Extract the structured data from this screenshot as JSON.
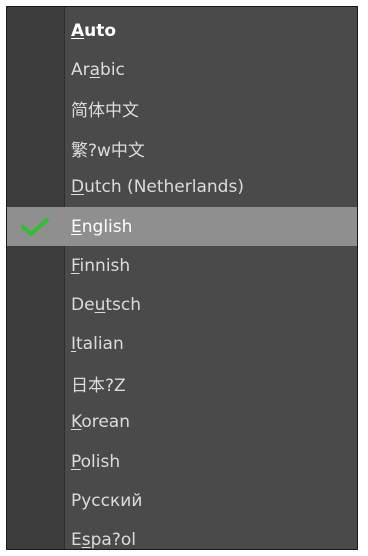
{
  "menu": {
    "items": [
      {
        "pre": "",
        "mn": "A",
        "post": "uto",
        "bold": true
      },
      {
        "pre": "Ar",
        "mn": "a",
        "post": "bic"
      },
      {
        "pre": "",
        "mn": "",
        "post": "简体中文"
      },
      {
        "pre": "",
        "mn": "",
        "post": "繁?w中文"
      },
      {
        "pre": "",
        "mn": "D",
        "post": "utch (Netherlands)"
      },
      {
        "pre": "",
        "mn": "E",
        "post": "nglish",
        "selected": true,
        "checked": true
      },
      {
        "pre": "",
        "mn": "F",
        "post": "innish"
      },
      {
        "pre": "De",
        "mn": "u",
        "post": "tsch"
      },
      {
        "pre": "",
        "mn": "I",
        "post": "talian"
      },
      {
        "pre": "",
        "mn": "",
        "post": "日本?Z"
      },
      {
        "pre": "",
        "mn": "K",
        "post": "orean"
      },
      {
        "pre": "",
        "mn": "P",
        "post": "olish"
      },
      {
        "pre": "",
        "mn": "",
        "post": "Русский"
      },
      {
        "pre": "E",
        "mn": "s",
        "post": "pa?ol"
      }
    ]
  },
  "colors": {
    "menu_bg": "#4a4a4a",
    "gutter_bg": "#3c3c3c",
    "selected_bg": "#8f8f8f",
    "text": "#dcdcdc",
    "check": "#2fbf2f"
  },
  "icons": {
    "check": "check-icon"
  }
}
